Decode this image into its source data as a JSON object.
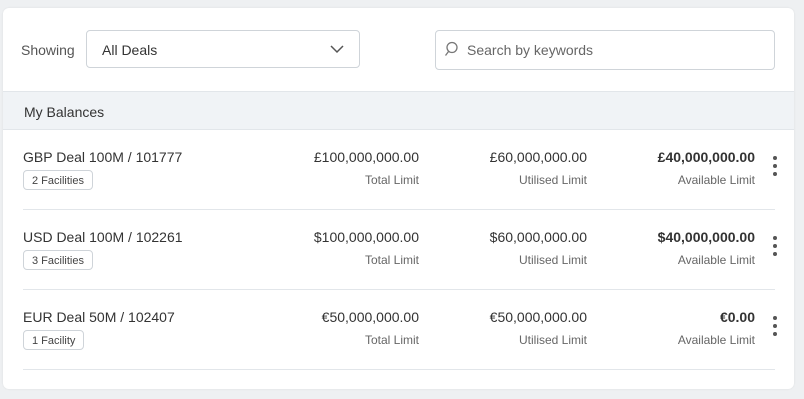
{
  "filters": {
    "showing_label": "Showing",
    "deal_filter": "All Deals",
    "search_placeholder": "Search by keywords"
  },
  "section": {
    "title": "My Balances"
  },
  "labels": {
    "total_limit": "Total Limit",
    "utilised_limit": "Utilised Limit",
    "available_limit": "Available Limit"
  },
  "deals": [
    {
      "name": "GBP Deal 100M / 101777",
      "facilities": "2 Facilities",
      "total_limit": "£100,000,000.00",
      "utilised_limit": "£60,000,000.00",
      "available_limit": "£40,000,000.00"
    },
    {
      "name": "USD Deal 100M / 102261",
      "facilities": "3 Facilities",
      "total_limit": "$100,000,000.00",
      "utilised_limit": "$60,000,000.00",
      "available_limit": "$40,000,000.00"
    },
    {
      "name": "EUR Deal 50M / 102407",
      "facilities": "1 Facility",
      "total_limit": "€50,000,000.00",
      "utilised_limit": "€50,000,000.00",
      "available_limit": "€0.00"
    }
  ],
  "icons": {
    "dropdown": "chevron-down-icon",
    "search": "search-icon",
    "row_menu": "more-vertical-icon"
  },
  "colors": {
    "background": "#eef0f2",
    "card": "#ffffff",
    "section_header": "#f0f3f6",
    "border": "#cfd4d9",
    "text": "#333333",
    "muted": "#666666"
  }
}
